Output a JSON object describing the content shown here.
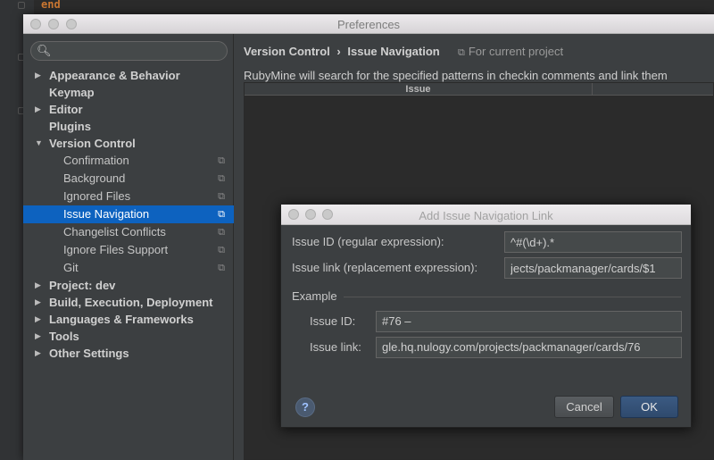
{
  "editor": {
    "code_text": "end"
  },
  "preferences": {
    "title": "Preferences",
    "search": {
      "placeholder": "",
      "value": ""
    },
    "tree": {
      "appearance": "Appearance & Behavior",
      "keymap": "Keymap",
      "editor": "Editor",
      "plugins": "Plugins",
      "version_control": "Version Control",
      "vc_children": [
        "Confirmation",
        "Background",
        "Ignored Files",
        "Issue Navigation",
        "Changelist Conflicts",
        "Ignore Files Support",
        "Git"
      ],
      "project": "Project: dev",
      "build": "Build, Execution, Deployment",
      "languages": "Languages & Frameworks",
      "tools": "Tools",
      "other": "Other Settings"
    },
    "selected_item": "Issue Navigation",
    "main": {
      "breadcrumb_parent": "Version Control",
      "breadcrumb_sep": "›",
      "breadcrumb_current": "Issue Navigation",
      "scope": "For current project",
      "description": "RubyMine will search for the specified patterns in checkin comments and link them",
      "table_column_issue": "Issue"
    }
  },
  "dialog": {
    "title": "Add Issue Navigation Link",
    "issue_id_label": "Issue ID (regular expression):",
    "issue_id_value": "^#(\\d+).*",
    "issue_link_label": "Issue link (replacement expression):",
    "issue_link_value": "jects/packmanager/cards/$1",
    "example_label": "Example",
    "example_id_label": "Issue ID:",
    "example_id_value": "#76 –",
    "example_link_label": "Issue link:",
    "example_link_value": "gle.hq.nulogy.com/projects/packmanager/cards/76",
    "help_label": "?",
    "cancel_label": "Cancel",
    "ok_label": "OK"
  }
}
